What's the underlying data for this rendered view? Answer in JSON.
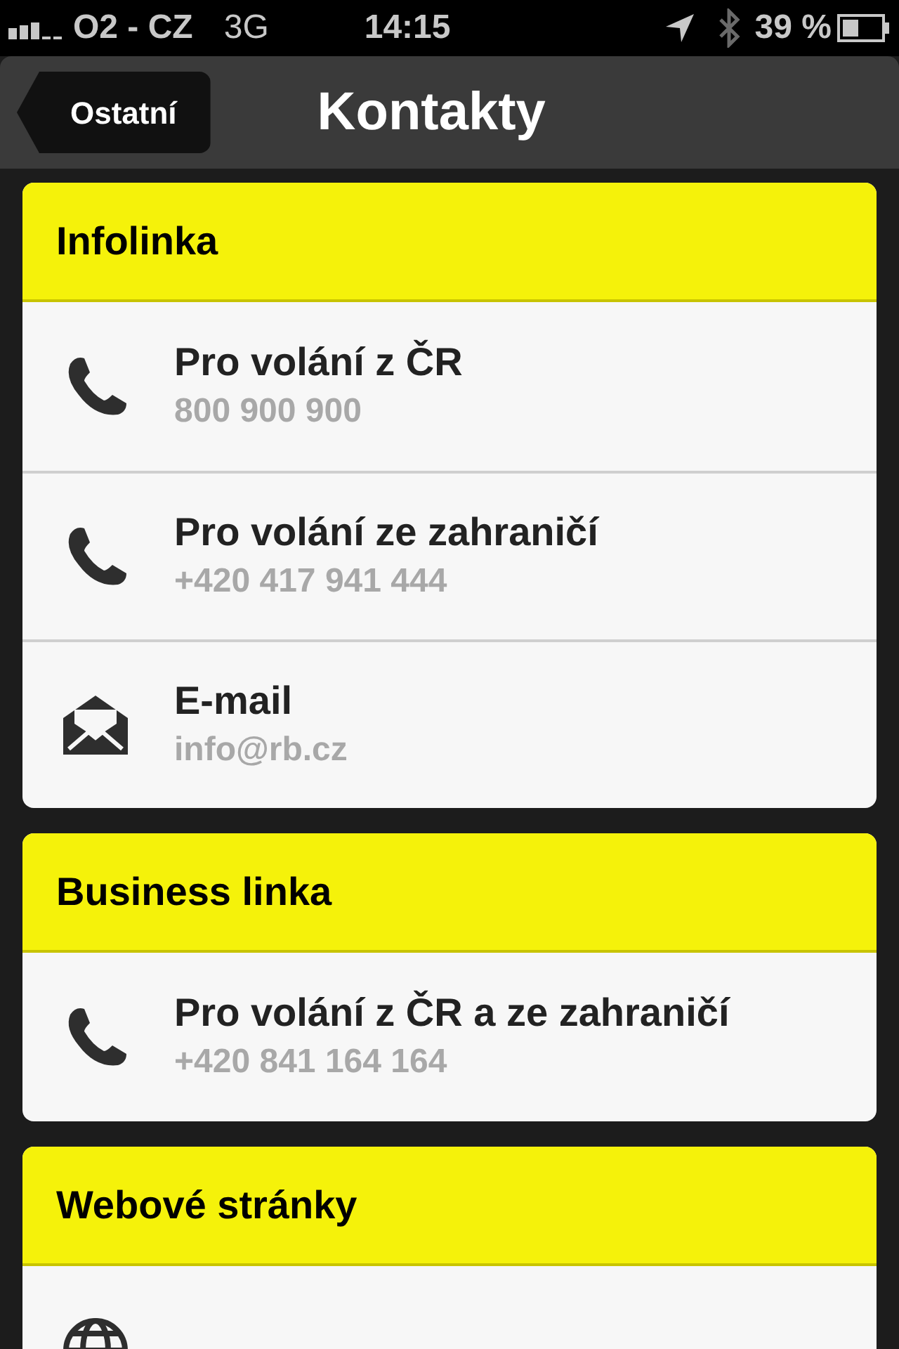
{
  "status_bar": {
    "carrier": "O2 - CZ",
    "network": "3G",
    "time": "14:15",
    "battery": "39 %"
  },
  "nav_bar": {
    "back": "Ostatní",
    "title": "Kontakty"
  },
  "sections": [
    {
      "title": "Infolinka",
      "items": [
        {
          "kind": "phone",
          "label": "Pro volání z ČR",
          "value": "800 900 900"
        },
        {
          "kind": "phone",
          "label": "Pro volání ze zahraničí",
          "value": "+420 417 941 444"
        },
        {
          "kind": "email",
          "label": "E-mail",
          "value": "info@rb.cz"
        }
      ]
    },
    {
      "title": "Business linka",
      "items": [
        {
          "kind": "phone",
          "label": "Pro volání z ČR a ze zahraničí",
          "value": "+420 841 164 164"
        }
      ]
    },
    {
      "title": "Webové stránky",
      "items": [
        {
          "kind": "web"
        }
      ]
    }
  ]
}
